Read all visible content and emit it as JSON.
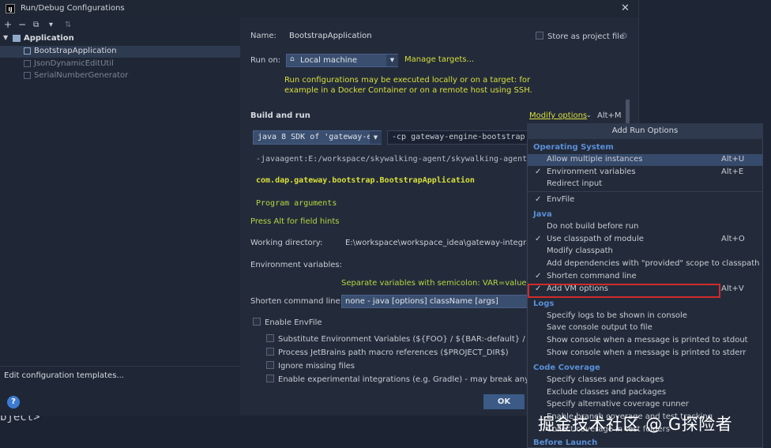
{
  "dialog": {
    "title": "Run/Debug Configurations",
    "app_icon": "IJ",
    "close": "✕"
  },
  "toolbar": [
    "+",
    "−",
    "⧉",
    "▾",
    "⇅"
  ],
  "tree": {
    "root": "Application",
    "items": [
      "BootstrapApplication",
      "JsonDynamicEditUtil",
      "SerialNumberGenerator"
    ]
  },
  "edit_templates": "Edit configuration templates...",
  "help": "?",
  "form": {
    "name_label": "Name:",
    "name_value": "BootstrapApplication",
    "store_label": "Store as project file",
    "run_on_label": "Run on:",
    "run_on_value": "Local machine",
    "manage_targets": "Manage targets...",
    "run_info_1": "Run configurations may be executed locally or on a target: for",
    "run_info_2": "example in a Docker Container or on a remote host using SSH.",
    "build_run": "Build and run",
    "modify_options": "Modify options",
    "modify_shortcut": "Alt+M",
    "jdk": "java 8 SDK of 'gateway-eng",
    "cp": "-cp gateway-engine-bootstrap",
    "vm_opts": "-javaagent:E:/workspace/skywalking-agent/skywalking-agent.jar=a",
    "main_class": "com.dap.gateway.bootstrap.BootstrapApplication",
    "program_args": "Program arguments",
    "alt_hint": "Press Alt for field hints",
    "workdir_label": "Working directory:",
    "workdir_value": "E:\\workspace\\workspace_idea\\gateway-integratic",
    "env_label": "Environment variables:",
    "env_hint": "Separate variables with semicolon: VAR=value; VAR",
    "shorten_label": "Shorten command line:",
    "shorten_value": "none - java [options] className [args]",
    "enable_envfile": "Enable EnvFile",
    "checks": [
      "Substitute Environment Variables (${FOO} / ${BAR:-default} / $${ESCA",
      "Process JetBrains path macro references ($PROJECT_DIR$)",
      "Ignore missing files",
      "Enable experimental integrations (e.g. Gradle) - may break any timel"
    ],
    "ok": "OK"
  },
  "popup": {
    "header": "Add Run Options",
    "sections": {
      "os": "Operating System",
      "java": "Java",
      "logs": "Logs",
      "coverage": "Code Coverage",
      "before": "Before Launch"
    },
    "os_items": [
      {
        "label": "Allow multiple instances",
        "check": "",
        "shortcut": "Alt+U"
      },
      {
        "label": "Environment variables",
        "check": "✓",
        "shortcut": "Alt+E"
      },
      {
        "label": "Redirect input",
        "check": "",
        "shortcut": ""
      },
      {
        "label": "EnvFile",
        "check": "✓",
        "shortcut": ""
      }
    ],
    "java_items": [
      {
        "label": "Do not build before run",
        "check": "",
        "shortcut": ""
      },
      {
        "label": "Use classpath of module",
        "check": "✓",
        "shortcut": "Alt+O"
      },
      {
        "label": "Modify classpath",
        "check": "",
        "shortcut": ""
      },
      {
        "label": "Add dependencies with \"provided\" scope to classpath",
        "check": "",
        "shortcut": ""
      },
      {
        "label": "Shorten command line",
        "check": "✓",
        "shortcut": ""
      },
      {
        "label": "Add VM options",
        "check": "✓",
        "shortcut": "Alt+V"
      }
    ],
    "log_items": [
      "Specify logs to be shown in console",
      "Save console output to file",
      "Show console when a message is printed to stdout",
      "Show console when a message is printed to stderr"
    ],
    "coverage_items": [
      "Specify classes and packages",
      "Exclude classes and packages",
      "Specify alternative coverage runner",
      "Enable branch coverage and test tracking",
      "Collect coverage in test folders"
    ]
  },
  "editor": {
    "code_fragment": "bject>"
  },
  "watermark": "掘金技术社区 @ G探险者"
}
